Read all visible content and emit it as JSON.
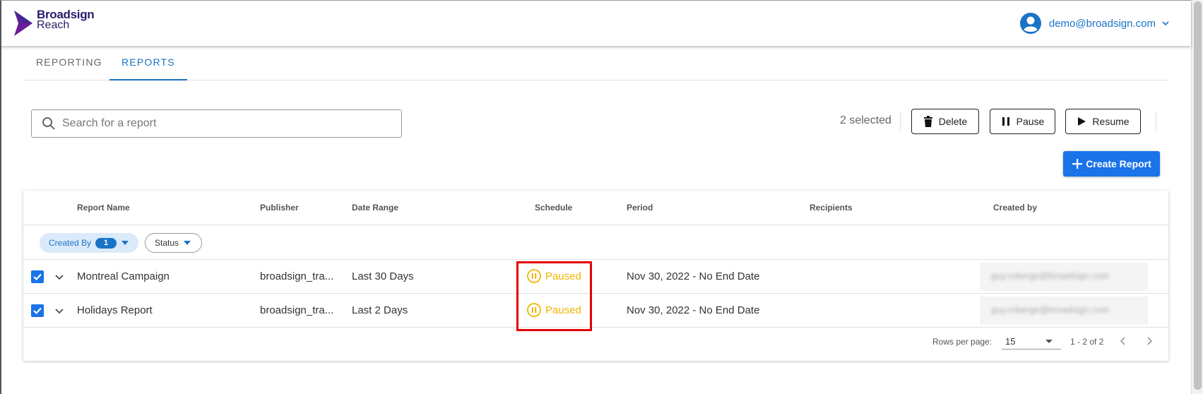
{
  "brand": {
    "line1": "Broadsign",
    "line2": "Reach",
    "color": "#2b1b6b",
    "accent": "#6a1b9a"
  },
  "user": {
    "email": "demo@broadsign.com",
    "icon": "account-circle-icon"
  },
  "tabs": [
    {
      "label": "REPORTING",
      "active": false
    },
    {
      "label": "REPORTS",
      "active": true
    }
  ],
  "search": {
    "placeholder": "Search for a report"
  },
  "selection": {
    "count_label": "2 selected"
  },
  "actions": {
    "delete": "Delete",
    "pause": "Pause",
    "resume": "Resume",
    "create": "Create Report"
  },
  "table": {
    "columns": [
      "Report Name",
      "Publisher",
      "Date Range",
      "Schedule",
      "Period",
      "Recipients",
      "Created by"
    ],
    "filters": {
      "created_by": "Created By",
      "created_by_count": "1",
      "status": "Status"
    },
    "rows": [
      {
        "checked": true,
        "name": "Montreal Campaign",
        "publisher": "broadsign_tra...",
        "date_range": "Last 30 Days",
        "schedule": "Paused",
        "period": "Nov 30, 2022 - No End Date",
        "recipients": "",
        "created_by": "guy.roberge@broadsign.com"
      },
      {
        "checked": true,
        "name": "Holidays Report",
        "publisher": "broadsign_tra...",
        "date_range": "Last 2 Days",
        "schedule": "Paused",
        "period": "Nov 30, 2022 - No End Date",
        "recipients": "",
        "created_by": "guy.roberge@broadsign.com"
      }
    ],
    "footer": {
      "rows_per_page_label": "Rows per page:",
      "rows_per_page": "15",
      "range": "1 - 2 of 2"
    }
  },
  "colors": {
    "primary": "#1a73e8",
    "paused": "#f0b400",
    "highlight": "#e10000"
  }
}
